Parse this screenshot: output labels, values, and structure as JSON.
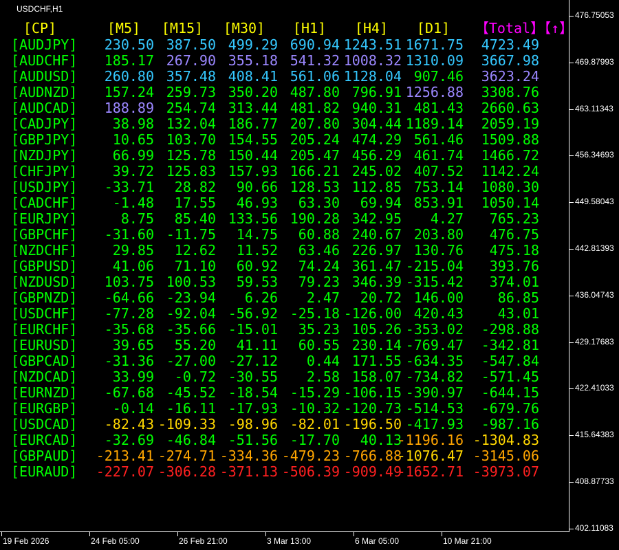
{
  "window": {
    "symbol_timeframe": "USDCHF,H1"
  },
  "table": {
    "headers": [
      "[CP]",
      "[M5]",
      "[M15]",
      "[M30]",
      "[H1]",
      "[H4]",
      "[D1]",
      "【Total】【↑】"
    ],
    "header_colors": [
      "#ffff00",
      "#ffff00",
      "#ffff00",
      "#ffff00",
      "#ffff00",
      "#ffff00",
      "#ffff00",
      "#ff00ff"
    ],
    "rows": [
      {
        "pair": "[AUDJPY]",
        "values": [
          "230.50",
          "387.50",
          "499.29",
          "690.94",
          "1243.51",
          "1671.75",
          "4723.49"
        ],
        "colors": [
          "#35c8ff",
          "#35c8ff",
          "#35c8ff",
          "#35c8ff",
          "#35c8ff",
          "#35c8ff",
          "#35c8ff"
        ]
      },
      {
        "pair": "[AUDCHF]",
        "values": [
          "185.17",
          "267.90",
          "355.18",
          "541.32",
          "1008.32",
          "1310.09",
          "3667.98"
        ],
        "colors": [
          "#00ff00",
          "#9b87ff",
          "#9b87ff",
          "#9b87ff",
          "#9b87ff",
          "#35c8ff",
          "#35c8ff"
        ]
      },
      {
        "pair": "[AUDUSD]",
        "values": [
          "260.80",
          "357.48",
          "408.41",
          "561.06",
          "1128.04",
          "907.46",
          "3623.24"
        ],
        "colors": [
          "#35c8ff",
          "#35c8ff",
          "#35c8ff",
          "#35c8ff",
          "#35c8ff",
          "#00ff00",
          "#9b87ff"
        ]
      },
      {
        "pair": "[AUDNZD]",
        "values": [
          "157.24",
          "259.73",
          "350.20",
          "487.80",
          "796.91",
          "1256.88",
          "3308.76"
        ],
        "colors": [
          "#00ff00",
          "#00ff00",
          "#00ff00",
          "#00ff00",
          "#00ff00",
          "#9b87ff",
          "#00ff00"
        ]
      },
      {
        "pair": "[AUDCAD]",
        "values": [
          "188.89",
          "254.74",
          "313.44",
          "481.82",
          "940.31",
          "481.43",
          "2660.63"
        ],
        "colors": [
          "#9b87ff",
          "#00ff00",
          "#00ff00",
          "#00ff00",
          "#00ff00",
          "#00ff00",
          "#00ff00"
        ]
      },
      {
        "pair": "[CADJPY]",
        "values": [
          "38.98",
          "132.04",
          "186.77",
          "207.80",
          "304.44",
          "1189.14",
          "2059.19"
        ],
        "colors": [
          "#00ff00",
          "#00ff00",
          "#00ff00",
          "#00ff00",
          "#00ff00",
          "#00ff00",
          "#00ff00"
        ]
      },
      {
        "pair": "[GBPJPY]",
        "values": [
          "10.65",
          "103.70",
          "154.55",
          "205.24",
          "474.29",
          "561.46",
          "1509.88"
        ],
        "colors": [
          "#00ff00",
          "#00ff00",
          "#00ff00",
          "#00ff00",
          "#00ff00",
          "#00ff00",
          "#00ff00"
        ]
      },
      {
        "pair": "[NZDJPY]",
        "values": [
          "66.99",
          "125.78",
          "150.44",
          "205.47",
          "456.29",
          "461.74",
          "1466.72"
        ],
        "colors": [
          "#00ff00",
          "#00ff00",
          "#00ff00",
          "#00ff00",
          "#00ff00",
          "#00ff00",
          "#00ff00"
        ]
      },
      {
        "pair": "[CHFJPY]",
        "values": [
          "39.72",
          "125.83",
          "157.93",
          "166.21",
          "245.02",
          "407.52",
          "1142.24"
        ],
        "colors": [
          "#00ff00",
          "#00ff00",
          "#00ff00",
          "#00ff00",
          "#00ff00",
          "#00ff00",
          "#00ff00"
        ]
      },
      {
        "pair": "[USDJPY]",
        "values": [
          "-33.71",
          "28.82",
          "90.66",
          "128.53",
          "112.85",
          "753.14",
          "1080.30"
        ],
        "colors": [
          "#00ff00",
          "#00ff00",
          "#00ff00",
          "#00ff00",
          "#00ff00",
          "#00ff00",
          "#00ff00"
        ]
      },
      {
        "pair": "[CADCHF]",
        "values": [
          "-1.48",
          "17.55",
          "46.93",
          "63.30",
          "69.94",
          "853.91",
          "1050.14"
        ],
        "colors": [
          "#00ff00",
          "#00ff00",
          "#00ff00",
          "#00ff00",
          "#00ff00",
          "#00ff00",
          "#00ff00"
        ]
      },
      {
        "pair": "[EURJPY]",
        "values": [
          "8.75",
          "85.40",
          "133.56",
          "190.28",
          "342.95",
          "4.27",
          "765.23"
        ],
        "colors": [
          "#00ff00",
          "#00ff00",
          "#00ff00",
          "#00ff00",
          "#00ff00",
          "#00ff00",
          "#00ff00"
        ]
      },
      {
        "pair": "[GBPCHF]",
        "values": [
          "-31.60",
          "-11.75",
          "14.75",
          "60.88",
          "240.67",
          "203.80",
          "476.75"
        ],
        "colors": [
          "#00ff00",
          "#00ff00",
          "#00ff00",
          "#00ff00",
          "#00ff00",
          "#00ff00",
          "#00ff00"
        ]
      },
      {
        "pair": "[NZDCHF]",
        "values": [
          "29.85",
          "12.62",
          "11.52",
          "63.46",
          "226.97",
          "130.76",
          "475.18"
        ],
        "colors": [
          "#00ff00",
          "#00ff00",
          "#00ff00",
          "#00ff00",
          "#00ff00",
          "#00ff00",
          "#00ff00"
        ]
      },
      {
        "pair": "[GBPUSD]",
        "values": [
          "41.06",
          "71.10",
          "60.92",
          "74.24",
          "361.47",
          "-215.04",
          "393.76"
        ],
        "colors": [
          "#00ff00",
          "#00ff00",
          "#00ff00",
          "#00ff00",
          "#00ff00",
          "#00ff00",
          "#00ff00"
        ]
      },
      {
        "pair": "[NZDUSD]",
        "values": [
          "103.75",
          "100.53",
          "59.53",
          "79.23",
          "346.39",
          "-315.42",
          "374.01"
        ],
        "colors": [
          "#00ff00",
          "#00ff00",
          "#00ff00",
          "#00ff00",
          "#00ff00",
          "#00ff00",
          "#00ff00"
        ]
      },
      {
        "pair": "[GBPNZD]",
        "values": [
          "-64.66",
          "-23.94",
          "6.26",
          "2.47",
          "20.72",
          "146.00",
          "86.85"
        ],
        "colors": [
          "#00ff00",
          "#00ff00",
          "#00ff00",
          "#00ff00",
          "#00ff00",
          "#00ff00",
          "#00ff00"
        ]
      },
      {
        "pair": "[USDCHF]",
        "values": [
          "-77.28",
          "-92.04",
          "-56.92",
          "-25.18",
          "-126.00",
          "420.43",
          "43.01"
        ],
        "colors": [
          "#00ff00",
          "#00ff00",
          "#00ff00",
          "#00ff00",
          "#00ff00",
          "#00ff00",
          "#00ff00"
        ]
      },
      {
        "pair": "[EURCHF]",
        "values": [
          "-35.68",
          "-35.66",
          "-15.01",
          "35.23",
          "105.26",
          "-353.02",
          "-298.88"
        ],
        "colors": [
          "#00ff00",
          "#00ff00",
          "#00ff00",
          "#00ff00",
          "#00ff00",
          "#00ff00",
          "#00ff00"
        ]
      },
      {
        "pair": "[EURUSD]",
        "values": [
          "39.65",
          "55.20",
          "41.11",
          "60.55",
          "230.14",
          "-769.47",
          "-342.81"
        ],
        "colors": [
          "#00ff00",
          "#00ff00",
          "#00ff00",
          "#00ff00",
          "#00ff00",
          "#00ff00",
          "#00ff00"
        ]
      },
      {
        "pair": "[GBPCAD]",
        "values": [
          "-31.36",
          "-27.00",
          "-27.12",
          "0.44",
          "171.55",
          "-634.35",
          "-547.84"
        ],
        "colors": [
          "#00ff00",
          "#00ff00",
          "#00ff00",
          "#00ff00",
          "#00ff00",
          "#00ff00",
          "#00ff00"
        ]
      },
      {
        "pair": "[NZDCAD]",
        "values": [
          "33.99",
          "-0.72",
          "-30.55",
          "2.58",
          "158.07",
          "-734.82",
          "-571.45"
        ],
        "colors": [
          "#00ff00",
          "#00ff00",
          "#00ff00",
          "#00ff00",
          "#00ff00",
          "#00ff00",
          "#00ff00"
        ]
      },
      {
        "pair": "[EURNZD]",
        "values": [
          "-67.68",
          "-45.52",
          "-18.54",
          "-15.29",
          "-106.15",
          "-390.97",
          "-644.15"
        ],
        "colors": [
          "#00ff00",
          "#00ff00",
          "#00ff00",
          "#00ff00",
          "#00ff00",
          "#00ff00",
          "#00ff00"
        ]
      },
      {
        "pair": "[EURGBP]",
        "values": [
          "-0.14",
          "-16.11",
          "-17.93",
          "-10.32",
          "-120.73",
          "-514.53",
          "-679.76"
        ],
        "colors": [
          "#00ff00",
          "#00ff00",
          "#00ff00",
          "#00ff00",
          "#00ff00",
          "#00ff00",
          "#00ff00"
        ]
      },
      {
        "pair": "[USDCAD]",
        "values": [
          "-82.43",
          "-109.33",
          "-98.96",
          "-82.01",
          "-196.50",
          "-417.93",
          "-987.16"
        ],
        "colors": [
          "#ffd700",
          "#ffd700",
          "#ffd700",
          "#ffd700",
          "#ffd700",
          "#00ff00",
          "#00ff00"
        ]
      },
      {
        "pair": "[EURCAD]",
        "values": [
          "-32.69",
          "-46.84",
          "-51.56",
          "-17.70",
          "40.13",
          "-1196.16",
          "-1304.83"
        ],
        "colors": [
          "#00ff00",
          "#00ff00",
          "#00ff00",
          "#00ff00",
          "#00ff00",
          "#ffa500",
          "#ffd700"
        ]
      },
      {
        "pair": "[GBPAUD]",
        "values": [
          "-213.41",
          "-274.71",
          "-334.36",
          "-479.23",
          "-766.88",
          "-1076.47",
          "-3145.06"
        ],
        "colors": [
          "#ffa500",
          "#ffa500",
          "#ffa500",
          "#ffa500",
          "#ffa500",
          "#ffd700",
          "#ffa500"
        ]
      },
      {
        "pair": "[EURAUD]",
        "values": [
          "-227.07",
          "-306.28",
          "-371.13",
          "-506.39",
          "-909.49",
          "-1652.71",
          "-3973.07"
        ],
        "colors": [
          "#ff2020",
          "#ff2020",
          "#ff2020",
          "#ff2020",
          "#ff2020",
          "#ff2020",
          "#ff2020"
        ]
      }
    ]
  },
  "price_axis": [
    "476.75053",
    "469.87993",
    "463.11343",
    "456.34693",
    "449.58043",
    "442.81393",
    "436.04743",
    "429.17683",
    "422.41033",
    "415.64383",
    "408.87733",
    "402.11083"
  ],
  "time_axis": [
    "19 Feb 2026",
    "24 Feb 05:00",
    "26 Feb 21:00",
    "3 Mar 13:00",
    "6 Mar 05:00",
    "10 Mar 21:00"
  ]
}
